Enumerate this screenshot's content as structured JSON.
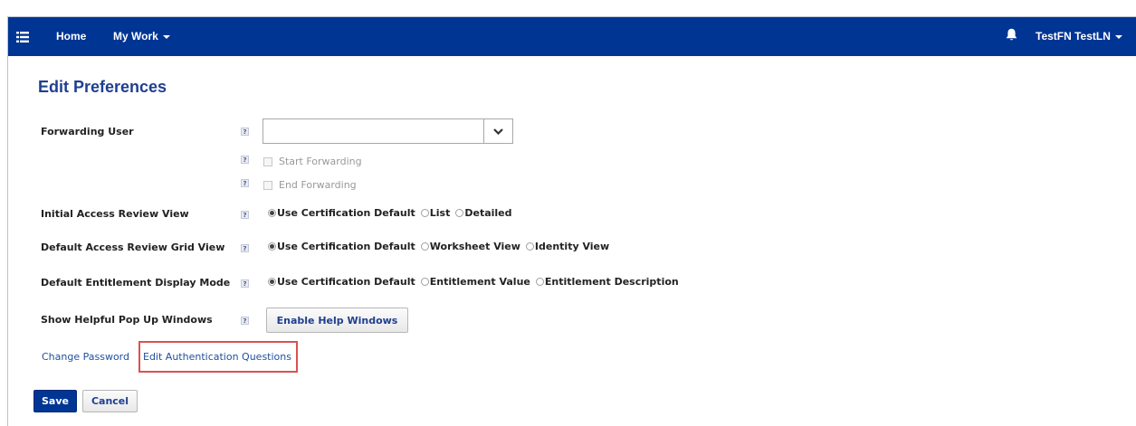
{
  "colors": {
    "navbar": "#003594",
    "title": "#1f3f8f",
    "link": "#1f4f9f",
    "highlight": "#d9534f"
  },
  "navbar": {
    "menu_icon": "list-menu-icon",
    "home": "Home",
    "my_work": "My Work",
    "bell_icon": "bell-icon",
    "user": "TestFN TestLN"
  },
  "page": {
    "title": "Edit Preferences"
  },
  "form": {
    "forwarding_user": {
      "label": "Forwarding User",
      "value": "",
      "start_label": "Start Forwarding",
      "end_label": "End Forwarding"
    },
    "initial_view": {
      "label": "Initial Access Review View",
      "options": [
        "Use Certification Default",
        "List",
        "Detailed"
      ],
      "selected": "Use Certification Default"
    },
    "grid_view": {
      "label": "Default Access Review Grid View",
      "options": [
        "Use Certification Default",
        "Worksheet View",
        "Identity View"
      ],
      "selected": "Use Certification Default"
    },
    "entitlement_mode": {
      "label": "Default Entitlement Display Mode",
      "options": [
        "Use Certification Default",
        "Entitlement Value",
        "Entitlement Description"
      ],
      "selected": "Use Certification Default"
    },
    "help_windows": {
      "label": "Show Helpful Pop Up Windows",
      "button": "Enable Help Windows"
    }
  },
  "links": {
    "change_password": "Change Password",
    "edit_auth": "Edit Authentication Questions"
  },
  "actions": {
    "save": "Save",
    "cancel": "Cancel"
  }
}
